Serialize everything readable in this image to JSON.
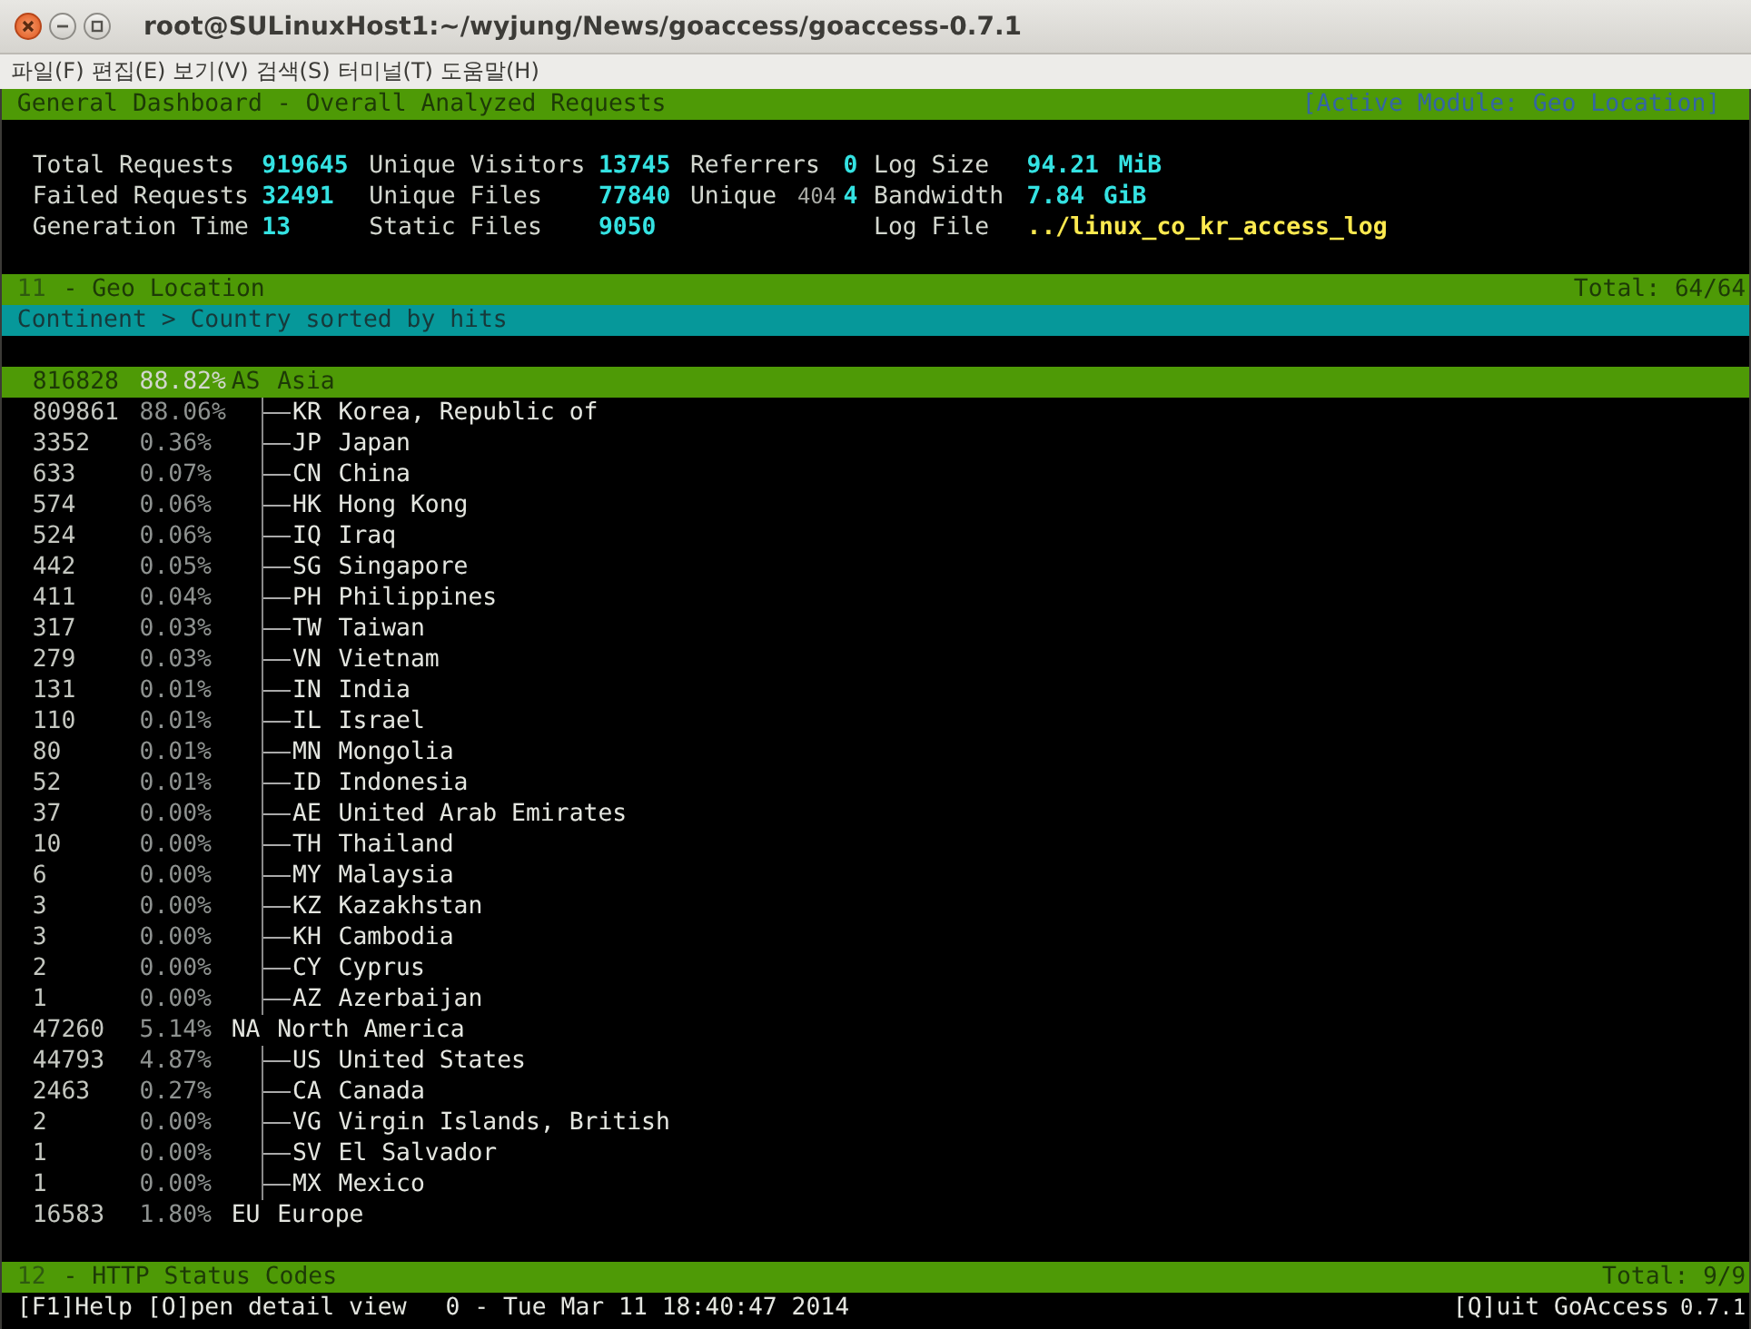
{
  "window": {
    "title": "root@SULinuxHost1:~/wyjung/News/goaccess/goaccess-0.7.1"
  },
  "menu": [
    "파일(F)",
    "편집(E)",
    "보기(V)",
    "검색(S)",
    "터미널(T)",
    "도움말(H)"
  ],
  "dashboard": {
    "title": "General Dashboard - Overall Analyzed Requests",
    "active_module": "[Active Module: Geo Location]",
    "stats": [
      {
        "items": [
          {
            "kind": "count",
            "label": "Total Requests",
            "value": "919645"
          },
          {
            "kind": "count",
            "label": "Failed Requests",
            "value": "32491"
          },
          {
            "kind": "count",
            "label": "Generation Time",
            "value": "13"
          }
        ]
      },
      {
        "items": [
          {
            "kind": "count",
            "label": "Unique Visitors",
            "value": "13745"
          },
          {
            "kind": "count",
            "label": "Unique Files",
            "value": "77840"
          },
          {
            "kind": "count",
            "label": "Static Files",
            "value": "9050"
          }
        ]
      },
      {
        "items": [
          {
            "kind": "count",
            "label": "Referrers",
            "value": "0"
          },
          {
            "kind": "count",
            "label": "Unique",
            "label_suffix": "404",
            "value": "4"
          }
        ]
      },
      {
        "items": [
          {
            "kind": "size",
            "label": "Log Size",
            "value": "94.21",
            "unit": "MiB"
          },
          {
            "kind": "size",
            "label": "Bandwidth",
            "value": "7.84",
            "unit": "GiB"
          },
          {
            "kind": "path",
            "label": "Log File",
            "value": "../linux_co_kr_access_log"
          }
        ]
      }
    ]
  },
  "panels": [
    {
      "number": "11",
      "title": "- Geo Location",
      "total_label": "Total:",
      "total": "64/64",
      "subtitle": "Continent > Country sorted by hits",
      "rows": [
        {
          "hits": "816828",
          "percent": "88.82%",
          "code": "AS",
          "name": "Asia",
          "selected": true,
          "children": [
            {
              "hits": "809861",
              "percent": "88.06%",
              "code": "KR",
              "name": "Korea, Republic of",
              "selected": false
            },
            {
              "hits": "3352",
              "percent": "0.36%",
              "code": "JP",
              "name": "Japan",
              "selected": false
            },
            {
              "hits": "633",
              "percent": "0.07%",
              "code": "CN",
              "name": "China",
              "selected": false
            },
            {
              "hits": "574",
              "percent": "0.06%",
              "code": "HK",
              "name": "Hong Kong",
              "selected": false
            },
            {
              "hits": "524",
              "percent": "0.06%",
              "code": "IQ",
              "name": "Iraq",
              "selected": false
            },
            {
              "hits": "442",
              "percent": "0.05%",
              "code": "SG",
              "name": "Singapore",
              "selected": false
            },
            {
              "hits": "411",
              "percent": "0.04%",
              "code": "PH",
              "name": "Philippines",
              "selected": false
            },
            {
              "hits": "317",
              "percent": "0.03%",
              "code": "TW",
              "name": "Taiwan",
              "selected": false
            },
            {
              "hits": "279",
              "percent": "0.03%",
              "code": "VN",
              "name": "Vietnam",
              "selected": false
            },
            {
              "hits": "131",
              "percent": "0.01%",
              "code": "IN",
              "name": "India",
              "selected": false
            },
            {
              "hits": "110",
              "percent": "0.01%",
              "code": "IL",
              "name": "Israel",
              "selected": false
            },
            {
              "hits": "80",
              "percent": "0.01%",
              "code": "MN",
              "name": "Mongolia",
              "selected": false
            },
            {
              "hits": "52",
              "percent": "0.01%",
              "code": "ID",
              "name": "Indonesia",
              "selected": false
            },
            {
              "hits": "37",
              "percent": "0.00%",
              "code": "AE",
              "name": "United Arab Emirates",
              "selected": false
            },
            {
              "hits": "10",
              "percent": "0.00%",
              "code": "TH",
              "name": "Thailand",
              "selected": false
            },
            {
              "hits": "6",
              "percent": "0.00%",
              "code": "MY",
              "name": "Malaysia",
              "selected": false
            },
            {
              "hits": "3",
              "percent": "0.00%",
              "code": "KZ",
              "name": "Kazakhstan",
              "selected": false
            },
            {
              "hits": "3",
              "percent": "0.00%",
              "code": "KH",
              "name": "Cambodia",
              "selected": false
            },
            {
              "hits": "2",
              "percent": "0.00%",
              "code": "CY",
              "name": "Cyprus",
              "selected": false
            },
            {
              "hits": "1",
              "percent": "0.00%",
              "code": "AZ",
              "name": "Azerbaijan",
              "selected": false
            }
          ]
        },
        {
          "hits": "47260",
          "percent": "5.14%",
          "code": "NA",
          "name": "North America",
          "selected": false,
          "children": [
            {
              "hits": "44793",
              "percent": "4.87%",
              "code": "US",
              "name": "United States",
              "selected": false
            },
            {
              "hits": "2463",
              "percent": "0.27%",
              "code": "CA",
              "name": "Canada",
              "selected": false
            },
            {
              "hits": "2",
              "percent": "0.00%",
              "code": "VG",
              "name": "Virgin Islands, British",
              "selected": false
            },
            {
              "hits": "1",
              "percent": "0.00%",
              "code": "SV",
              "name": "El Salvador",
              "selected": false
            },
            {
              "hits": "1",
              "percent": "0.00%",
              "code": "MX",
              "name": "Mexico",
              "selected": false
            }
          ]
        },
        {
          "hits": "16583",
          "percent": "1.80%",
          "code": "EU",
          "name": "Europe",
          "selected": false
        }
      ]
    },
    {
      "number": "12",
      "title": "- HTTP Status Codes",
      "total_label": "Total:",
      "total": "9/9"
    }
  ],
  "footer": {
    "help": "[F1]Help [O]pen detail view",
    "timestamp": "0 - Tue Mar 11 18:40:47 2014",
    "quit": "[Q]uit GoAccess",
    "version": "0.7.1"
  }
}
